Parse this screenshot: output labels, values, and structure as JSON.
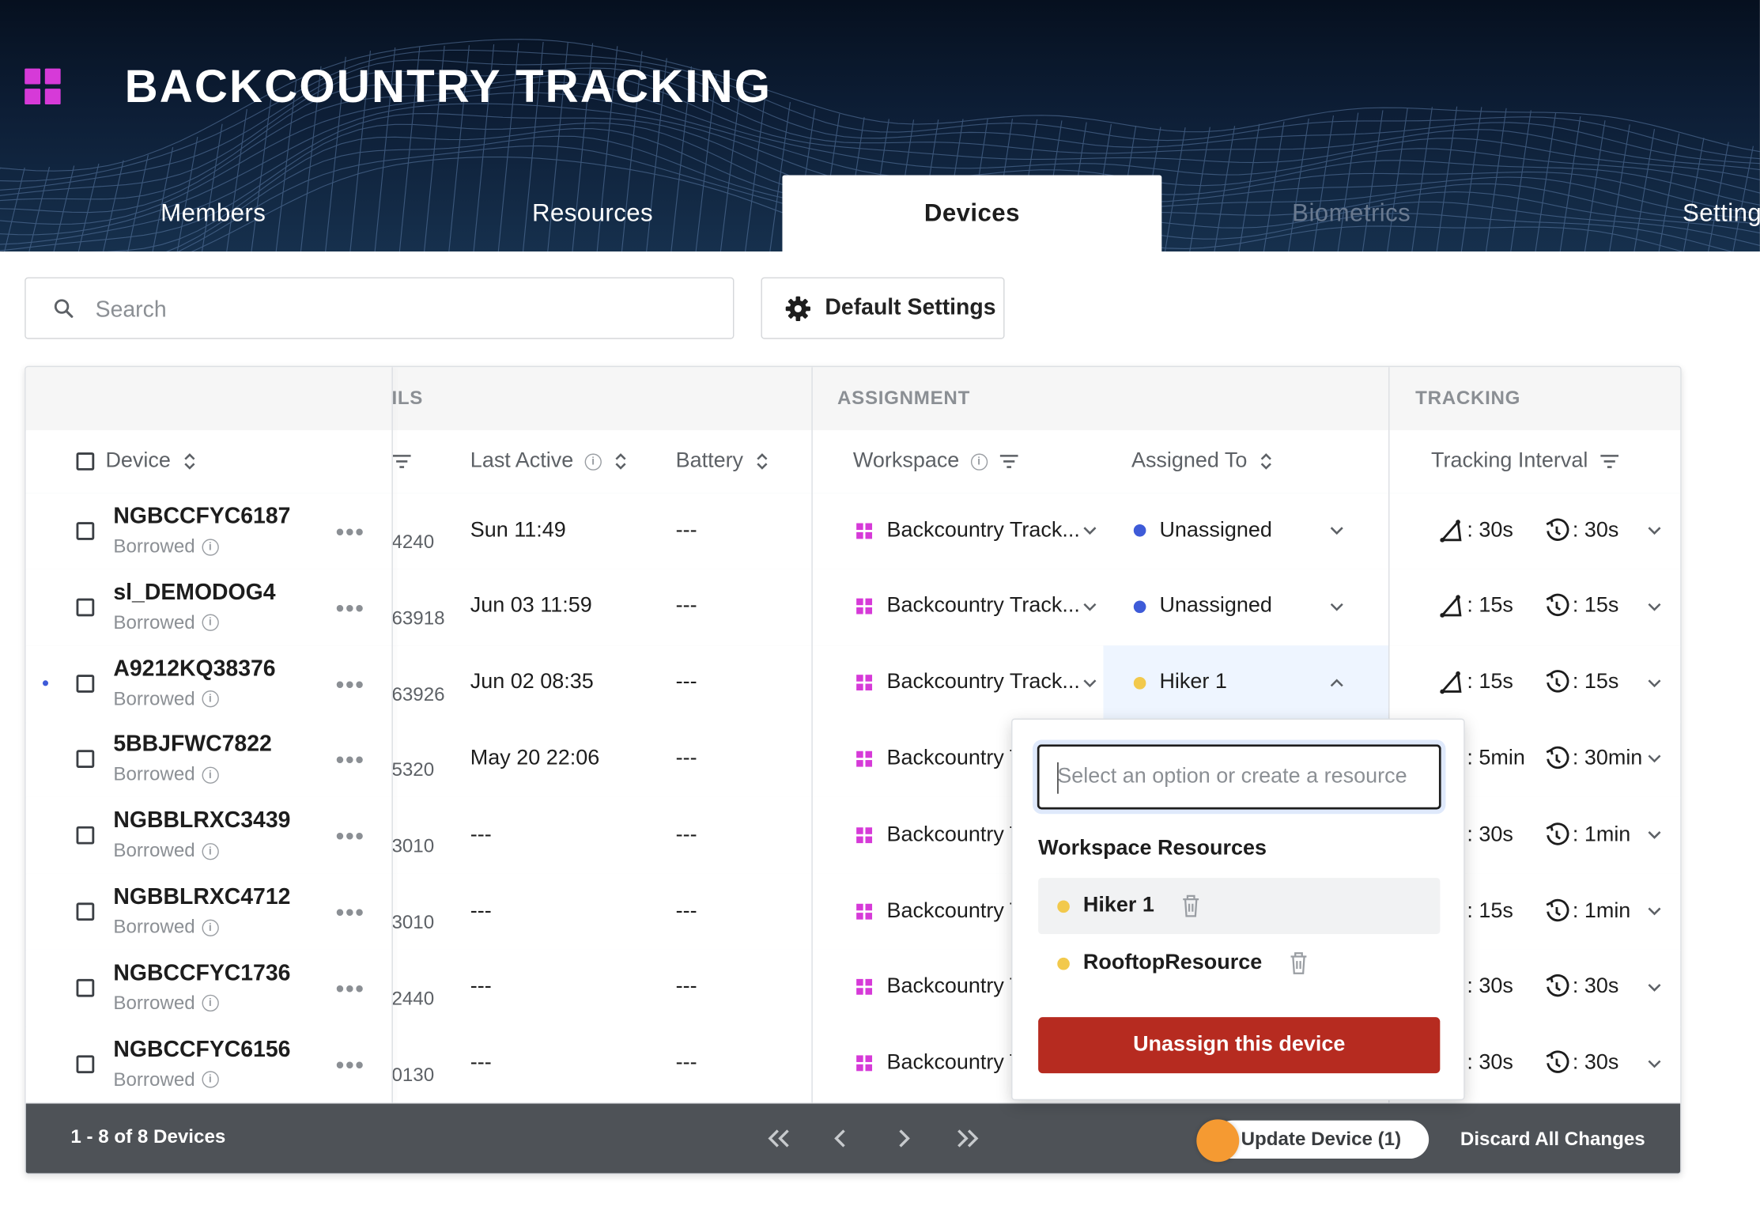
{
  "app": {
    "title": "BACKCOUNTRY TRACKING",
    "logo_icon": "grid-logo-icon",
    "accent_color": "#d63ad8"
  },
  "tabs": [
    {
      "label": "Members",
      "state": "normal"
    },
    {
      "label": "Resources",
      "state": "normal"
    },
    {
      "label": "Devices",
      "state": "active"
    },
    {
      "label": "Biometrics",
      "state": "disabled"
    },
    {
      "label": "Setting",
      "state": "normal"
    }
  ],
  "toolbar": {
    "search_placeholder": "Search",
    "search_icon": "search-icon",
    "default_settings_label": "Default Settings",
    "default_settings_icon": "gear-icon"
  },
  "table": {
    "groups": {
      "details": "ILS",
      "assignment": "ASSIGNMENT",
      "tracking": "TRACKING"
    },
    "columns": {
      "device": "Device",
      "last_active": "Last Active",
      "battery": "Battery",
      "workspace": "Workspace",
      "assigned_to": "Assigned To",
      "tracking_interval": "Tracking Interval"
    },
    "rows": [
      {
        "device": "NGBCCFYC6187",
        "status": "Borrowed",
        "id_fragment": "4240",
        "last_active": "Sun 11:49",
        "battery": "---",
        "workspace": "Backcountry Track...",
        "assigned": "Unassigned",
        "assigned_color": "#3e5bd8",
        "loc_interval": ": 30s",
        "hb_interval": ": 30s"
      },
      {
        "device": "sl_DEMODOG4",
        "status": "Borrowed",
        "id_fragment": "63918",
        "last_active": "Jun 03 11:59",
        "battery": "---",
        "workspace": "Backcountry Track...",
        "assigned": "Unassigned",
        "assigned_color": "#3e5bd8",
        "loc_interval": ": 15s",
        "hb_interval": ": 15s"
      },
      {
        "device": "A9212KQ38376",
        "status": "Borrowed",
        "id_fragment": "63926",
        "last_active": "Jun 02 08:35",
        "battery": "---",
        "workspace": "Backcountry Track...",
        "assigned": "Hiker 1",
        "assigned_color": "#f2c94c",
        "loc_interval": ": 15s",
        "hb_interval": ": 15s"
      },
      {
        "device": "5BBJFWC7822",
        "status": "Borrowed",
        "id_fragment": "5320",
        "last_active": "May 20 22:06",
        "battery": "---",
        "workspace": "Backcountry T",
        "assigned": "",
        "assigned_color": "",
        "loc_interval": ": 5min",
        "hb_interval": ": 30min"
      },
      {
        "device": "NGBBLRXC3439",
        "status": "Borrowed",
        "id_fragment": "3010",
        "last_active": "---",
        "battery": "---",
        "workspace": "Backcountry T",
        "assigned": "",
        "assigned_color": "",
        "loc_interval": ": 30s",
        "hb_interval": ": 1min"
      },
      {
        "device": "NGBBLRXC4712",
        "status": "Borrowed",
        "id_fragment": "3010",
        "last_active": "---",
        "battery": "---",
        "workspace": "Backcountry T",
        "assigned": "",
        "assigned_color": "",
        "loc_interval": ": 15s",
        "hb_interval": ": 1min"
      },
      {
        "device": "NGBCCFYC1736",
        "status": "Borrowed",
        "id_fragment": "2440",
        "last_active": "---",
        "battery": "---",
        "workspace": "Backcountry T",
        "assigned": "",
        "assigned_color": "",
        "loc_interval": ": 30s",
        "hb_interval": ": 30s"
      },
      {
        "device": "NGBCCFYC6156",
        "status": "Borrowed",
        "id_fragment": "0130",
        "last_active": "---",
        "battery": "---",
        "workspace": "Backcountry T",
        "assigned": "",
        "assigned_color": "",
        "loc_interval": ": 30s",
        "hb_interval": ": 30s"
      }
    ]
  },
  "popover": {
    "input_placeholder": "Select an option or create a resource",
    "section_title": "Workspace Resources",
    "options": [
      {
        "label": "Hiker 1",
        "dot_color": "#f2c94c",
        "selected": true
      },
      {
        "label": "RooftopResource",
        "dot_color": "#f2c94c",
        "selected": false
      }
    ],
    "unassign_label": "Unassign this device"
  },
  "footer": {
    "count_label": "1 - 8 of 8 Devices",
    "update_label": "Update Device (1)",
    "discard_label": "Discard All Changes"
  }
}
